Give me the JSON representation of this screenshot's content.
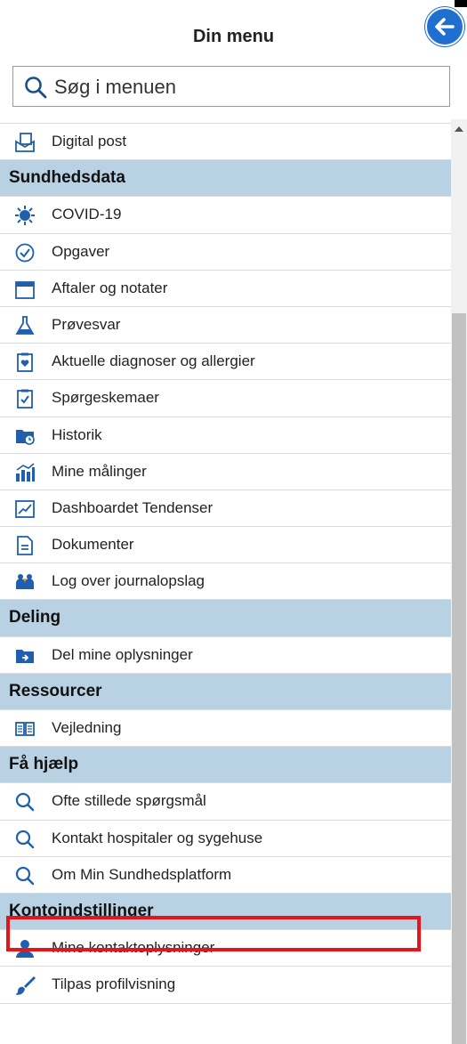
{
  "header": {
    "title": "Din menu"
  },
  "search": {
    "placeholder": "Søg i menuen"
  },
  "menu": {
    "digital_post": "Digital post",
    "sundhedsdata": {
      "heading": "Sundhedsdata",
      "items": [
        "COVID-19",
        "Opgaver",
        "Aftaler og notater",
        "Prøvesvar",
        "Aktuelle diagnoser og allergier",
        "Spørgeskemaer",
        "Historik",
        "Mine målinger",
        "Dashboardet Tendenser",
        "Dokumenter",
        "Log over journalopslag"
      ]
    },
    "deling": {
      "heading": "Deling",
      "items": [
        "Del mine oplysninger"
      ]
    },
    "ressourcer": {
      "heading": "Ressourcer",
      "items": [
        "Vejledning"
      ]
    },
    "faa_hjaelp": {
      "heading": "Få hjælp",
      "items": [
        "Ofte stillede spørgsmål",
        "Kontakt hospitaler og sygehuse",
        "Om Min Sundhedsplatform"
      ]
    },
    "kontoindstillinger": {
      "heading": "Kontoindstillinger",
      "items": [
        "Mine kontaktoplysninger",
        "Tilpas profilvisning"
      ]
    }
  },
  "colors": {
    "accent": "#1f6fd1",
    "section_bg": "#b8d2e4",
    "highlight": "#e8141b"
  }
}
